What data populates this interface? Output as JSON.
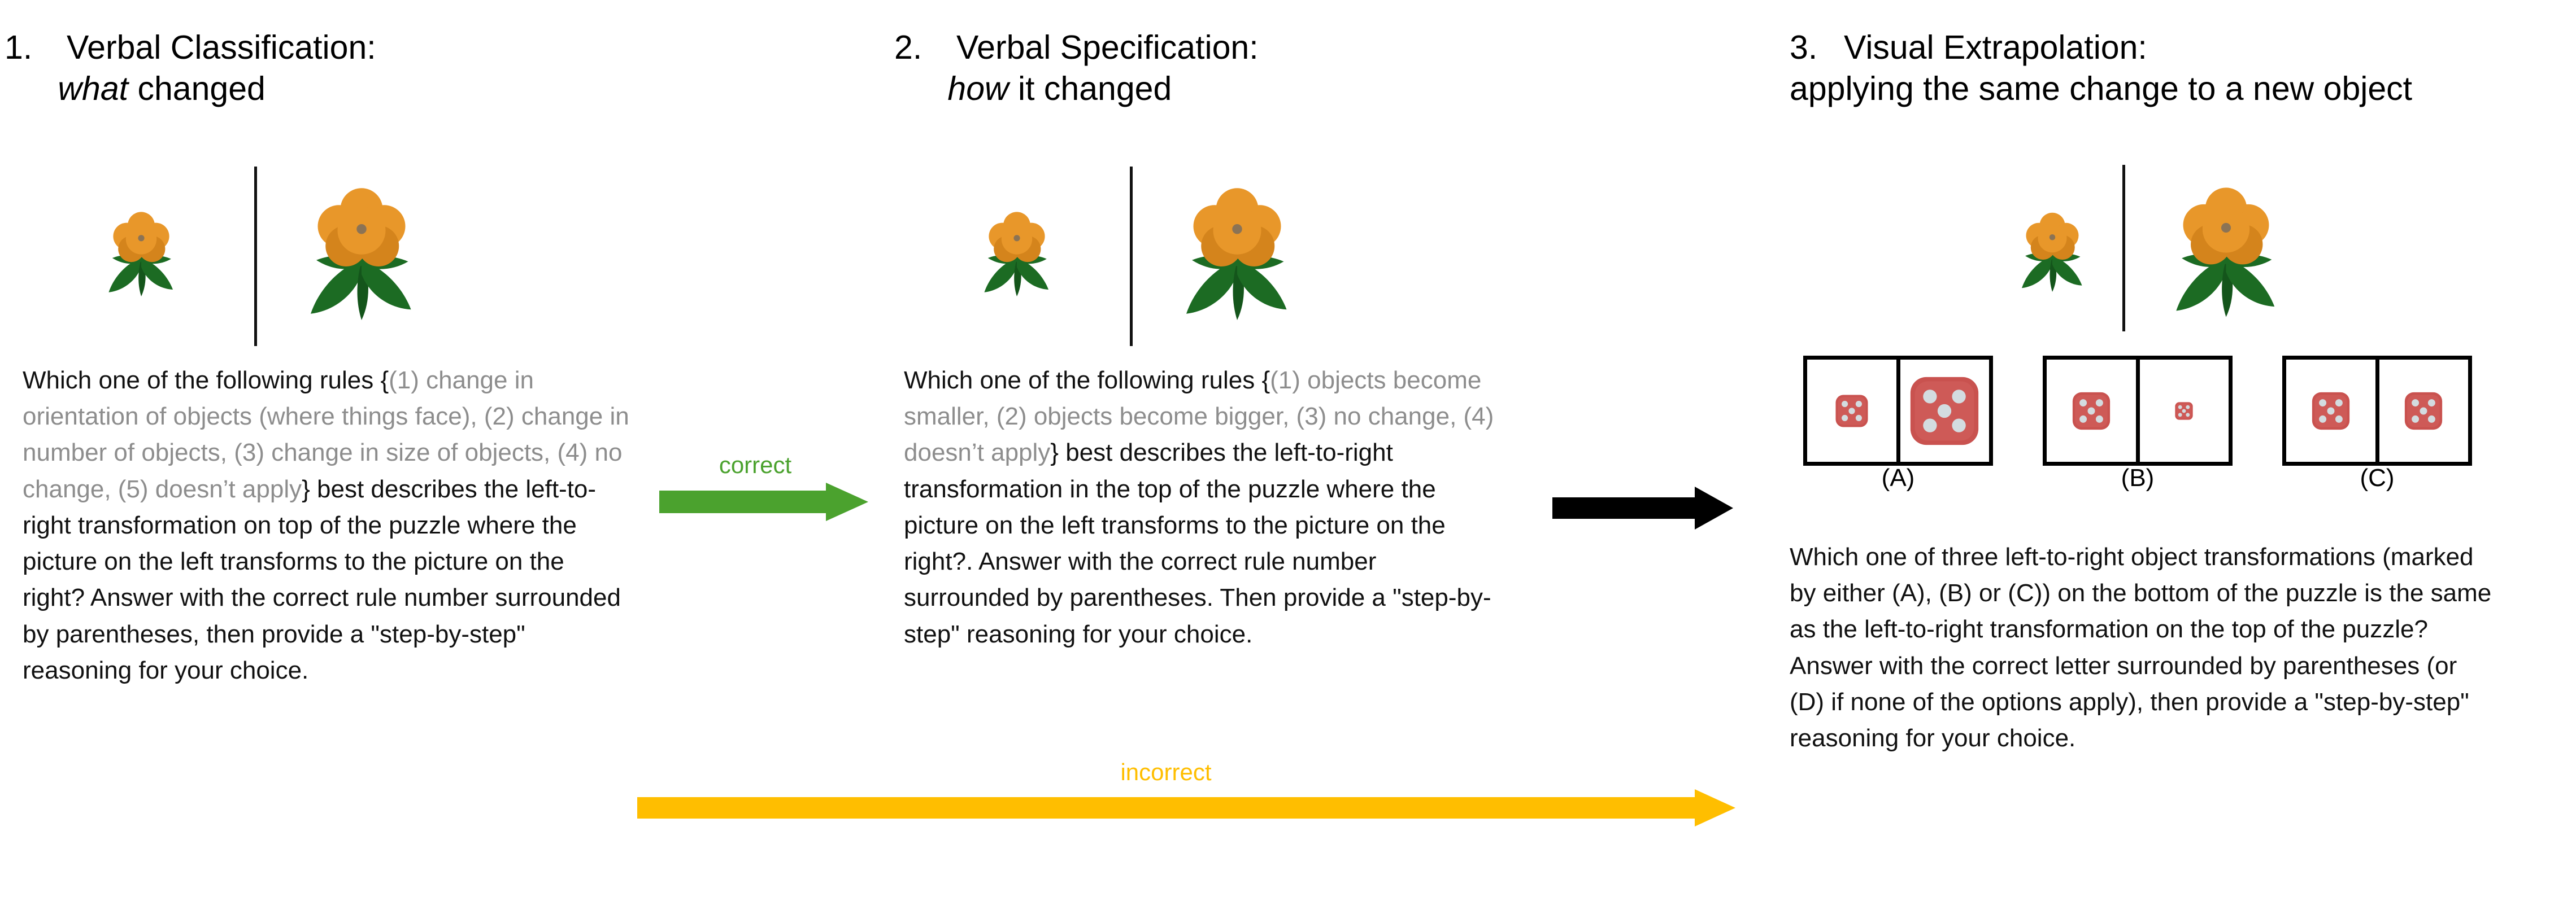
{
  "figure": {
    "background_color": "#ffffff",
    "text_color": "#111111",
    "muted_text_color": "#8d8d8d"
  },
  "panels": [
    {
      "index": "1.",
      "title": "Verbal Classification:",
      "subtitle_italic": "what",
      "subtitle_rest": " changed",
      "prompt": {
        "lead": "Which one of the following rules {",
        "options_muted": "(1) change in orientation of objects (where things face), (2) change in number of objects, (3) change in size of objects, (4) no change, (5) doesn’t apply",
        "tail": "} best describes the left-to-right transformation on top of the puzzle where the picture on the left transforms to the picture on the right? Answer with the correct rule number surrounded by parentheses, then provide a \"step-by-step\" reasoning for your choice."
      },
      "stimulus": {
        "left_object": "flower-small",
        "right_object": "flower-large",
        "divider": "vertical-rule"
      }
    },
    {
      "index": "2.",
      "title": "Verbal Specification:",
      "subtitle_italic": "how",
      "subtitle_rest": " it changed",
      "prompt": {
        "lead": "Which one of the following rules {",
        "options_muted": "(1) objects become smaller, (2) objects become bigger, (3) no change, (4) doesn’t apply",
        "tail": "} best describes the left-to-right transformation in the top of the puzzle where the picture on the left transforms to the picture on the right?. Answer with the correct rule number surrounded by parentheses. Then provide a \"step-by-step\" reasoning for your choice."
      },
      "stimulus": {
        "left_object": "flower-small",
        "right_object": "flower-large",
        "divider": "vertical-rule"
      }
    },
    {
      "index": "3.",
      "title": "Visual Extrapolation:",
      "subtitle_italic": "",
      "subtitle_rest": "applying the same change to a new object",
      "prompt": {
        "lead": "",
        "options_muted": "",
        "tail": "Which one of three left-to-right object transformations (marked by either (A), (B) or (C)) on the bottom of the puzzle is the same as the left-to-right transformation on the top of the puzzle? Answer with the correct letter surrounded by parentheses (or (D) if none of the options apply), then provide a \"step-by-step\" reasoning for your choice."
      },
      "stimulus": {
        "left_object": "flower-small",
        "right_object": "flower-large",
        "divider": "vertical-rule"
      },
      "options": [
        {
          "label": "(A)",
          "left_die": {
            "size": 62,
            "pips": 5
          },
          "right_die": {
            "size": 122,
            "pips": 5
          },
          "relation": "bigger"
        },
        {
          "label": "(B)",
          "left_die": {
            "size": 72,
            "pips": 5
          },
          "right_die": {
            "size": 34,
            "pips": 5
          },
          "relation": "smaller"
        },
        {
          "label": "(C)",
          "left_die": {
            "size": 72,
            "pips": 5
          },
          "right_die": {
            "size": 72,
            "pips": 5
          },
          "relation": "no change"
        }
      ]
    }
  ],
  "arrows": [
    {
      "id": "correct-arrow",
      "label": "correct",
      "color": "#4BA22E",
      "from": "panel-1",
      "to": "panel-2"
    },
    {
      "id": "black-arrow",
      "label": "",
      "color": "#000000",
      "from": "panel-2",
      "to": "panel-3"
    },
    {
      "id": "incorrect-arrow",
      "label": "incorrect",
      "color": "#FFBE00",
      "from": "panel-1",
      "to": "panel-3"
    }
  ],
  "colors": {
    "flower_petal": "#E8972A",
    "flower_petal_dark": "#D4841C",
    "flower_center": "#8B7355",
    "leaf": "#1C6B23",
    "leaf_dark": "#14551B",
    "die_body": "#C9524F",
    "die_body_light": "#D97670",
    "die_pip": "#D3DCE0",
    "rule_black": "#111111"
  }
}
